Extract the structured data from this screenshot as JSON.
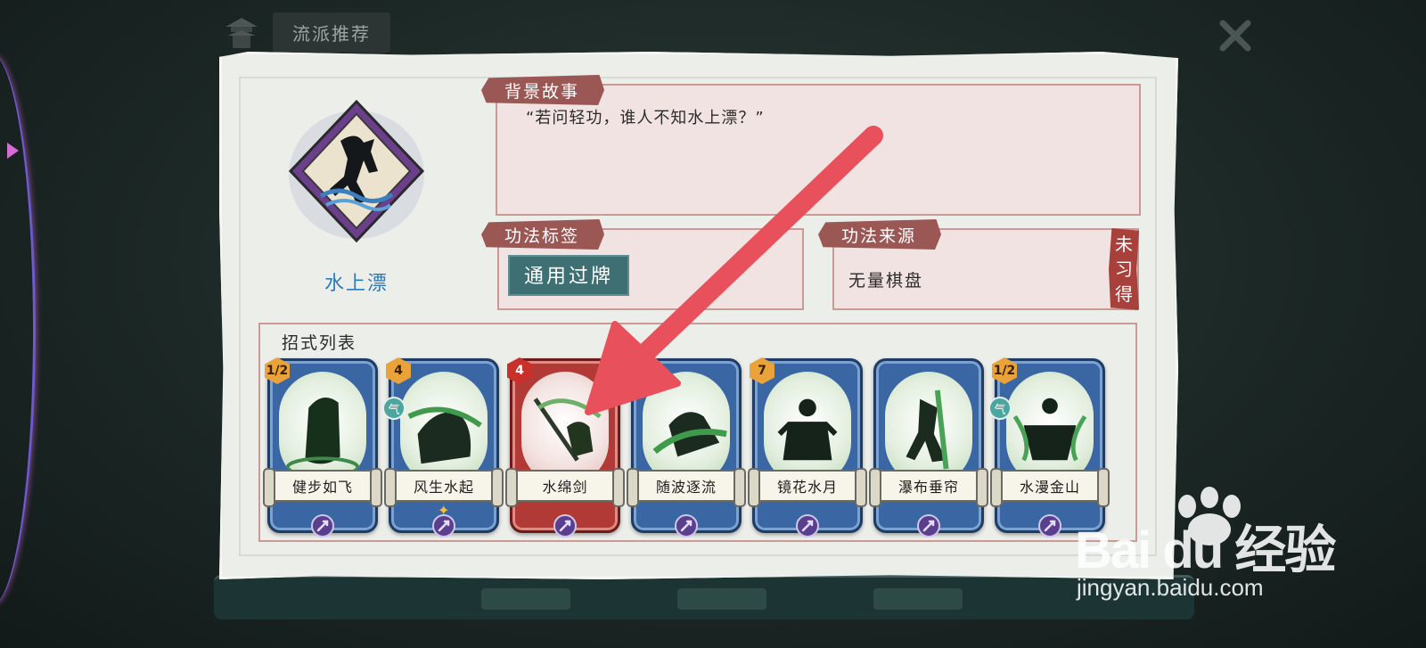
{
  "header": {
    "title": "流派推荐"
  },
  "skill": {
    "name": "水上漂",
    "story_label": "背景故事",
    "story_text": "“若问轻功，谁人不知水上漂？”",
    "tag_label": "功法标签",
    "tag_value": "通用过牌",
    "source_label": "功法来源",
    "source_value": "无量棋盘",
    "status_stamp": "未习得"
  },
  "moves": {
    "title": "招式列表",
    "cards": [
      {
        "name": "健步如飞",
        "cost": "1/2",
        "qi": "",
        "plus": "",
        "color": "blue"
      },
      {
        "name": "风生水起",
        "cost": "4",
        "qi": "气",
        "plus": "✦",
        "color": "blue"
      },
      {
        "name": "水绵剑",
        "cost": "4",
        "qi": "",
        "plus": "",
        "color": "red"
      },
      {
        "name": "随波逐流",
        "cost": "",
        "qi": "",
        "plus": "",
        "color": "blue"
      },
      {
        "name": "镜花水月",
        "cost": "7",
        "qi": "",
        "plus": "",
        "color": "blue"
      },
      {
        "name": "瀑布垂帘",
        "cost": "",
        "qi": "",
        "plus": "",
        "color": "blue"
      },
      {
        "name": "水漫金山",
        "cost": "1/2",
        "qi": "气",
        "plus": "",
        "color": "blue"
      }
    ]
  },
  "watermark": {
    "brand": "Bai du 经验",
    "url": "jingyan.baidu.com"
  },
  "colors": {
    "label_bg": "#9b5754",
    "card_blue": "#3a67a3",
    "card_red": "#b23a36",
    "name_blue": "#2f7ab8",
    "arrow": "#e8505b"
  }
}
